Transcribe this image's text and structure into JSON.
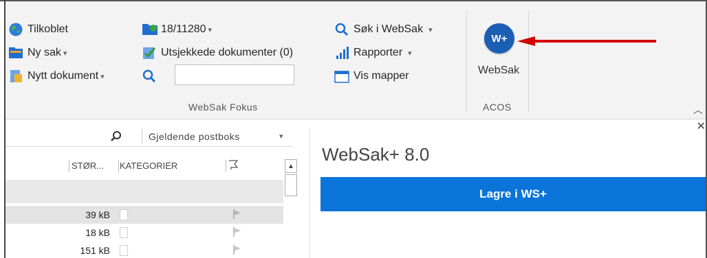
{
  "ribbon": {
    "connection": {
      "label": "Tilkoblet",
      "icon": "globe-icon"
    },
    "new_case": {
      "label": "Ny sak",
      "icon": "folder-icon"
    },
    "new_document": {
      "label": "Nytt dokument",
      "icon": "document-icon"
    },
    "case_number": {
      "label": "18/11280",
      "icon": "case-folder-icon"
    },
    "checked_out": {
      "label": "Utsjekkede dokumenter (0)",
      "icon": "checkmark-document-icon"
    },
    "search_field": {
      "value": "",
      "icon": "search-icon"
    },
    "search_websak": {
      "label": "Søk i WebSak",
      "icon": "search-icon"
    },
    "reports": {
      "label": "Rapporter",
      "icon": "bar-chart-icon"
    },
    "show_folders": {
      "label": "Vis mapper",
      "icon": "folder-window-icon"
    },
    "group_fokus_label": "WebSak Fokus",
    "websak_button": {
      "icon_text": "W+",
      "label": "WebSak"
    },
    "group_acos_label": "ACOS"
  },
  "mail_list": {
    "search_scope": "Gjeldende postboks",
    "columns": [
      "STØR...",
      "KATEGORIER"
    ],
    "rows": [
      {
        "size": "39 kB",
        "selected": true
      },
      {
        "size": "18 kB",
        "selected": false
      },
      {
        "size": "151 kB",
        "selected": false
      }
    ]
  },
  "addin": {
    "title": "WebSak+ 8.0",
    "save_button": "Lagre i WS+"
  },
  "colors": {
    "accent_blue": "#0a74d9",
    "websak_circle": "#1a5fb4",
    "arrow_red": "#d40000",
    "ribbon_bg": "#f3f3f3"
  }
}
